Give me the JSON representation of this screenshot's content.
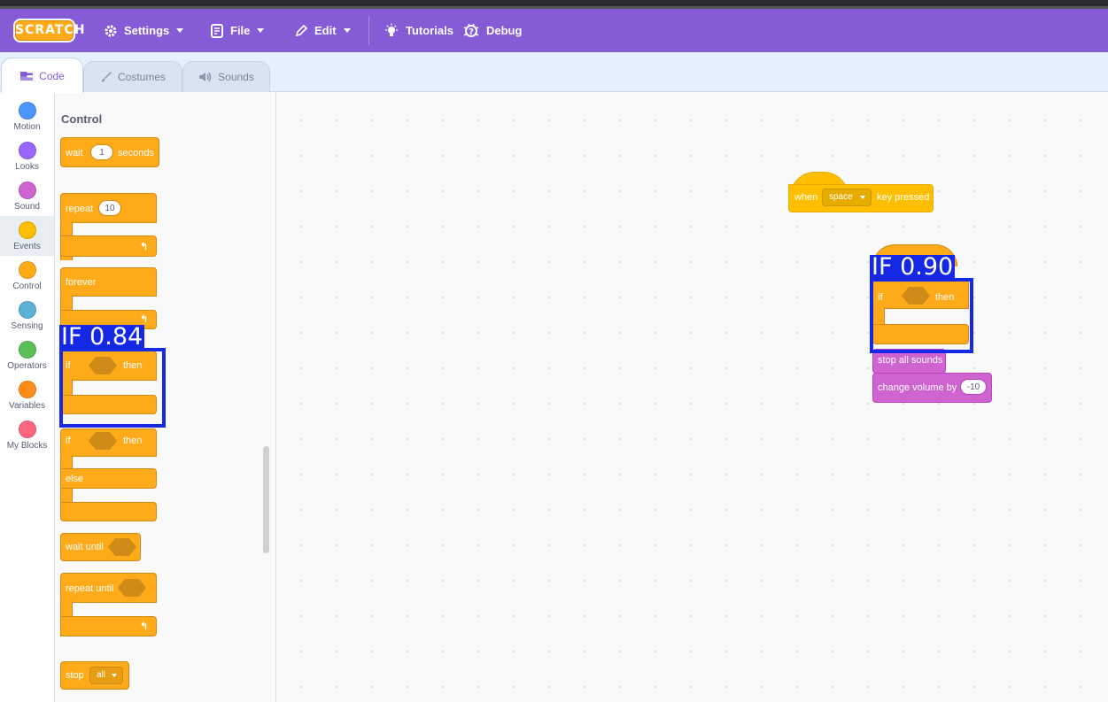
{
  "menubar": {
    "logo": "SCRATCH",
    "settings_label": "Settings",
    "file_label": "File",
    "edit_label": "Edit",
    "tutorials_label": "Tutorials",
    "debug_label": "Debug"
  },
  "tabs": {
    "code": "Code",
    "costumes": "Costumes",
    "sounds": "Sounds"
  },
  "categories": [
    {
      "label": "Motion",
      "color": "#4c97ff"
    },
    {
      "label": "Looks",
      "color": "#9966ff"
    },
    {
      "label": "Sound",
      "color": "#cf63cf"
    },
    {
      "label": "Events",
      "color": "#ffbf00"
    },
    {
      "label": "Control",
      "color": "#ffab19"
    },
    {
      "label": "Sensing",
      "color": "#5cb1d6"
    },
    {
      "label": "Operators",
      "color": "#59c059"
    },
    {
      "label": "Variables",
      "color": "#ff8c1a"
    },
    {
      "label": "My Blocks",
      "color": "#ff6680"
    }
  ],
  "palette": {
    "title": "Control",
    "wait": {
      "label": "wait",
      "value": "1",
      "unit": "seconds"
    },
    "repeat": {
      "label": "repeat",
      "value": "10"
    },
    "forever": {
      "label": "forever"
    },
    "if_then": {
      "if": "if",
      "then": "then"
    },
    "if_else": {
      "if": "if",
      "then": "then",
      "else": "else"
    },
    "wait_until": {
      "label": "wait until"
    },
    "repeat_until": {
      "label": "repeat until"
    },
    "stop": {
      "label": "stop",
      "option": "all"
    }
  },
  "workspace": {
    "hat": {
      "when": "when",
      "key": "space",
      "suffix": "key pressed"
    },
    "if_block": {
      "if": "if",
      "then": "then"
    },
    "stop_sounds": "stop all sounds",
    "change_volume": {
      "label": "change volume by",
      "value": "-10"
    }
  },
  "detections": [
    {
      "label": "IF 0.84"
    },
    {
      "label": "IF 0.90"
    }
  ],
  "colors": {
    "accent": "#855cd6",
    "control": "#ffab19",
    "sound": "#cf63cf",
    "detection": "#1428e6"
  }
}
